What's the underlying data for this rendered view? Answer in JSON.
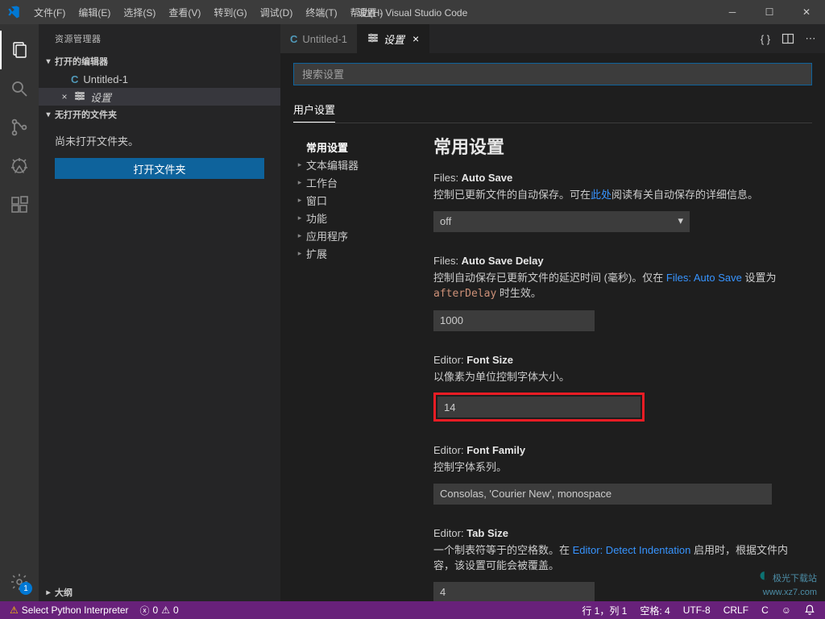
{
  "titlebar": {
    "menus": [
      "文件(F)",
      "编辑(E)",
      "选择(S)",
      "查看(V)",
      "转到(G)",
      "调试(D)",
      "终端(T)",
      "帮助(H)"
    ],
    "title": "设置 - Visual Studio Code"
  },
  "sidebar": {
    "title": "资源管理器",
    "open_editors_header": "打开的编辑器",
    "open_editors": [
      {
        "label": "Untitled-1",
        "icon": "C",
        "active": false
      },
      {
        "label": "设置",
        "icon": "gear",
        "active": true
      }
    ],
    "no_folder_header": "无打开的文件夹",
    "no_folder_msg": "尚未打开文件夹。",
    "open_folder_btn": "打开文件夹",
    "outline_header": "大纲"
  },
  "tabs": [
    {
      "label": "Untitled-1",
      "icon": "C",
      "active": false,
      "closable": false
    },
    {
      "label": "设置",
      "icon": "gear",
      "active": true,
      "closable": true,
      "italic": true
    }
  ],
  "settings": {
    "search_placeholder": "搜索设置",
    "scope_tabs": [
      "用户设置"
    ],
    "toc": [
      {
        "label": "常用设置",
        "active": true
      },
      {
        "label": "文本编辑器"
      },
      {
        "label": "工作台"
      },
      {
        "label": "窗口"
      },
      {
        "label": "功能"
      },
      {
        "label": "应用程序"
      },
      {
        "label": "扩展"
      }
    ],
    "heading": "常用设置",
    "items": {
      "autoSave": {
        "label_prefix": "Files: ",
        "label_strong": "Auto Save",
        "desc_pre": "控制已更新文件的自动保存。可在",
        "desc_link": "此处",
        "desc_post": "阅读有关自动保存的详细信息。",
        "value": "off"
      },
      "autoSaveDelay": {
        "label_prefix": "Files: ",
        "label_strong": "Auto Save Delay",
        "desc_pre": "控制自动保存已更新文件的延迟时间 (毫秒)。仅在 ",
        "desc_link": "Files: Auto Save",
        "desc_post": " 设置为",
        "desc_code": "afterDelay",
        "desc_tail": " 时生效。",
        "value": "1000"
      },
      "fontSize": {
        "label_prefix": "Editor: ",
        "label_strong": "Font Size",
        "desc": "以像素为单位控制字体大小。",
        "value": "14"
      },
      "fontFamily": {
        "label_prefix": "Editor: ",
        "label_strong": "Font Family",
        "desc": "控制字体系列。",
        "value": "Consolas, 'Courier New', monospace"
      },
      "tabSize": {
        "label_prefix": "Editor: ",
        "label_strong": "Tab Size",
        "desc_pre": "一个制表符等于的空格数。在 ",
        "desc_link": "Editor: Detect Indentation",
        "desc_post": " 启用时，根据文件内容，该设置可能会被覆盖。",
        "value": "4"
      }
    }
  },
  "status": {
    "python_warn": "Select Python Interpreter",
    "errors": "0",
    "warnings": "0",
    "ln_col": "行 1，列 1",
    "spaces": "空格: 4",
    "encoding": "UTF-8",
    "eol": "CRLF",
    "lang": "C",
    "feedback": "☺"
  },
  "activity_badge": "1",
  "watermark": {
    "line1": "极光下载站",
    "line2": "www.xz7.com"
  }
}
